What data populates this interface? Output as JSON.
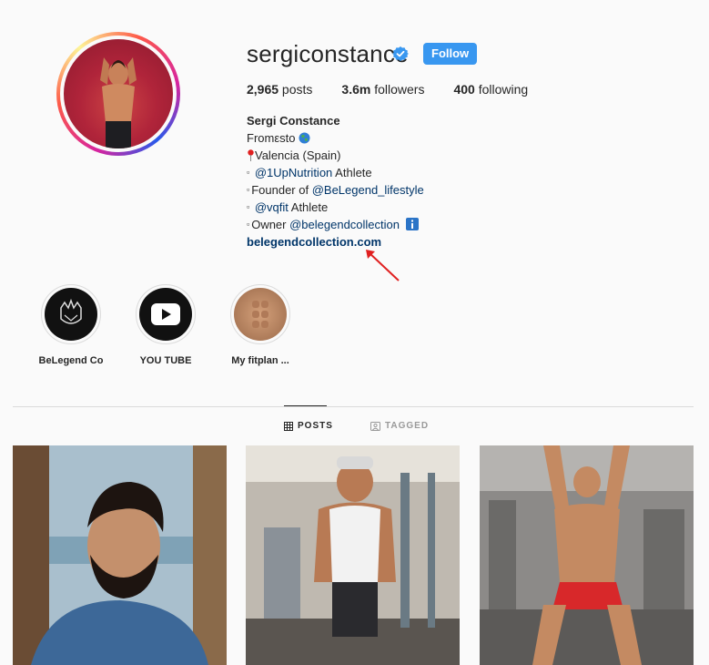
{
  "profile": {
    "username": "sergiconstance",
    "follow_label": "Follow",
    "stats": {
      "posts_count": "2,965",
      "posts_label": " posts",
      "followers_count": "3.6m",
      "followers_label": " followers",
      "following_count": "400",
      "following_label": " following"
    },
    "bio": {
      "full_name": "Sergi Constance",
      "from_line": "Fromεsto",
      "location": "Valencia (Spain)",
      "line3_mention": "@1UpNutrition",
      "line3_suffix": " Athlete",
      "line4_prefix": "Founder of ",
      "line4_mention": "@BeLegend_lifestyle",
      "line5_mention": "@vqfit",
      "line5_suffix": " Athlete",
      "line6_prefix": "Owner ",
      "line6_mention": "@belegendcollection",
      "website": "belegendcollection.com"
    }
  },
  "highlights": [
    {
      "label": "BeLegend Co"
    },
    {
      "label": "YOU TUBE"
    },
    {
      "label": "My fitplan ..."
    }
  ],
  "tabs": {
    "posts": "POSTS",
    "tagged": "TAGGED"
  },
  "colors": {
    "follow_button": "#3897f0",
    "link": "#003569",
    "annotation_arrow": "#e02020"
  }
}
